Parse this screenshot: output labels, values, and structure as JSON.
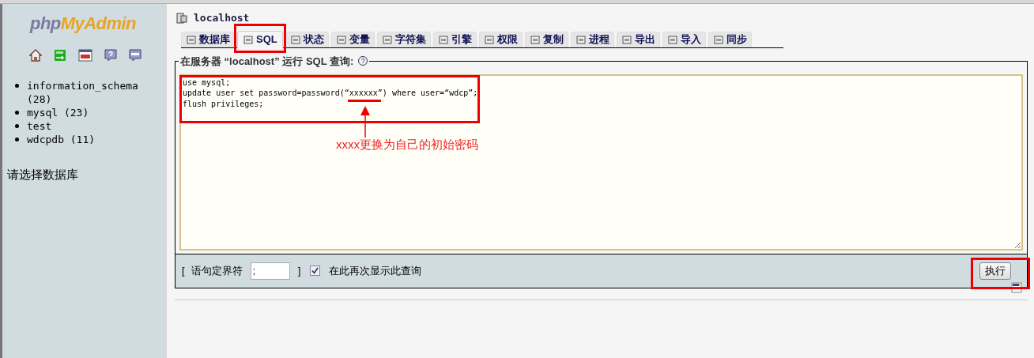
{
  "sidebar": {
    "logo": {
      "prefix": "php",
      "name": "MyAdmin"
    },
    "databases": [
      {
        "name": "information_schema (28)"
      },
      {
        "name": "mysql (23)"
      },
      {
        "name": "test"
      },
      {
        "name": "wdcpdb (11)"
      }
    ],
    "hint": "请选择数据库"
  },
  "server": {
    "title": "localhost"
  },
  "tabs": [
    {
      "label": "数据库",
      "selected": false
    },
    {
      "label": "SQL",
      "selected": true
    },
    {
      "label": "状态",
      "selected": false
    },
    {
      "label": "变量",
      "selected": false
    },
    {
      "label": "字符集",
      "selected": false
    },
    {
      "label": "引擎",
      "selected": false
    },
    {
      "label": "权限",
      "selected": false
    },
    {
      "label": "复制",
      "selected": false
    },
    {
      "label": "进程",
      "selected": false
    },
    {
      "label": "导出",
      "selected": false
    },
    {
      "label": "导入",
      "selected": false
    },
    {
      "label": "同步",
      "selected": false
    }
  ],
  "query": {
    "legend": "在服务器 “localhost” 运行 SQL 查询:",
    "help": "?",
    "value": "use mysql;\nupdate user set password=password(“xxxxxx”) where user=“wdcp”;\nflush privileges;",
    "delimiter_label_open": "[",
    "delimiter_label": "语句定界符",
    "delimiter": ";",
    "delimiter_label_close": "]",
    "show_again": {
      "label": "在此再次显示此查询",
      "checked": true
    },
    "submit": "执行"
  },
  "annotation": {
    "text": "xxxx更换为自己的初始密码"
  }
}
